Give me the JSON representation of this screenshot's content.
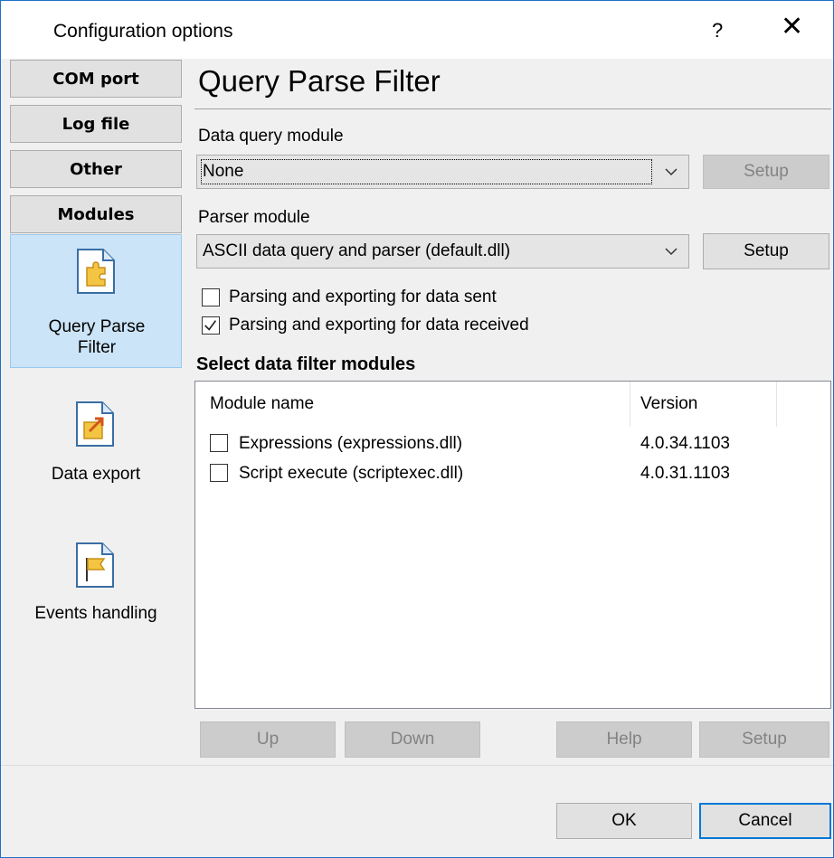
{
  "window": {
    "title": "Configuration options",
    "help_glyph": "?",
    "close_glyph": "✕"
  },
  "nav": {
    "buttons": [
      "COM port",
      "Log file",
      "Other",
      "Modules"
    ],
    "icons": [
      {
        "label_line1": "Query Parse",
        "label_line2": "Filter",
        "icon": "puzzle-document-icon",
        "selected": true
      },
      {
        "label_line1": "Data export",
        "icon": "export-document-icon",
        "selected": false
      },
      {
        "label_line1": "Events handling",
        "icon": "flag-document-icon",
        "selected": false
      }
    ]
  },
  "main": {
    "title": "Query Parse Filter",
    "data_query": {
      "label": "Data query module",
      "value": "None",
      "setup_label": "Setup"
    },
    "parser": {
      "label": "Parser module",
      "value": "ASCII data query and parser (default.dll)",
      "setup_label": "Setup"
    },
    "checks": [
      {
        "label": "Parsing and exporting for data sent",
        "checked": false
      },
      {
        "label": "Parsing and exporting for data received",
        "checked": true
      }
    ],
    "filter_section": "Select data filter modules",
    "table": {
      "columns": [
        "Module name",
        "Version"
      ],
      "rows": [
        {
          "name": "Expressions (expressions.dll)",
          "version": "4.0.34.1103",
          "checked": false
        },
        {
          "name": "Script execute (scriptexec.dll)",
          "version": "4.0.31.1103",
          "checked": false
        }
      ]
    },
    "buttons": {
      "up": "Up",
      "down": "Down",
      "help": "Help",
      "setup": "Setup"
    }
  },
  "footer": {
    "ok": "OK",
    "cancel": "Cancel"
  },
  "colors": {
    "accent": "#0078d7",
    "selection": "#cce4f7",
    "border": "#1e6fc8"
  }
}
